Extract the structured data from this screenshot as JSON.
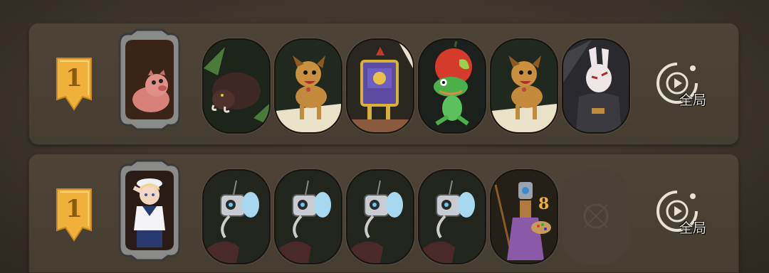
{
  "rows": [
    {
      "rank": "1",
      "hero": "pig-hero",
      "cards": [
        "wild-boar",
        "yellow-dog",
        "golden-treasure-chest",
        "frog-with-apple-helmet",
        "yellow-dog",
        "masked-rabbit-assassin"
      ],
      "replay_label": "全局"
    },
    {
      "rank": "1",
      "hero": "sailor-girl-hero",
      "cards": [
        "camera-robot",
        "camera-robot",
        "camera-robot",
        "camera-robot",
        "painter-robot",
        "empty-slot"
      ],
      "replay_label": "全局"
    }
  ],
  "colors": {
    "rank_badge": "#f0b03a",
    "card_bg": "#1c1a17",
    "panel": "#4a4034"
  }
}
